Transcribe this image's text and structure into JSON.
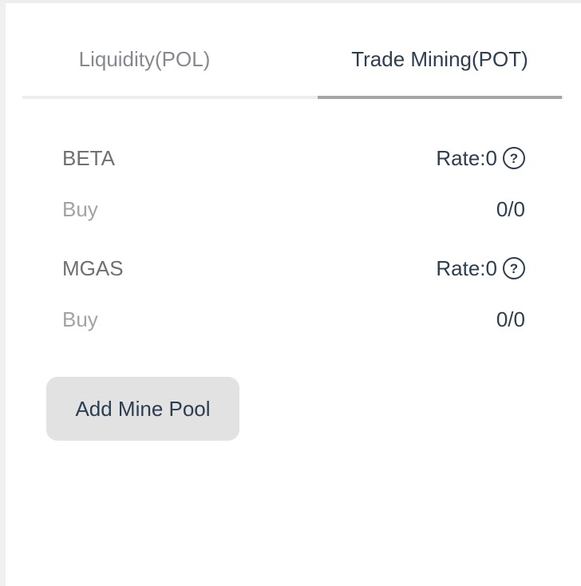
{
  "tabs": [
    {
      "label": "Liquidity(POL)",
      "active": false
    },
    {
      "label": "Trade Mining(POT)",
      "active": true
    }
  ],
  "pools": [
    {
      "name": "BETA",
      "rate": "Rate:0",
      "action": "Buy",
      "amount": "0/0"
    },
    {
      "name": "MGAS",
      "rate": "Rate:0",
      "action": "Buy",
      "amount": "0/0"
    }
  ],
  "add_pool_label": "Add Mine Pool",
  "help_glyph": "?",
  "colors": {
    "text_dark": "#2c3e50",
    "text_muted": "#858a90",
    "active_underline": "#a5a5a5",
    "button_bg": "#e2e2e2"
  }
}
